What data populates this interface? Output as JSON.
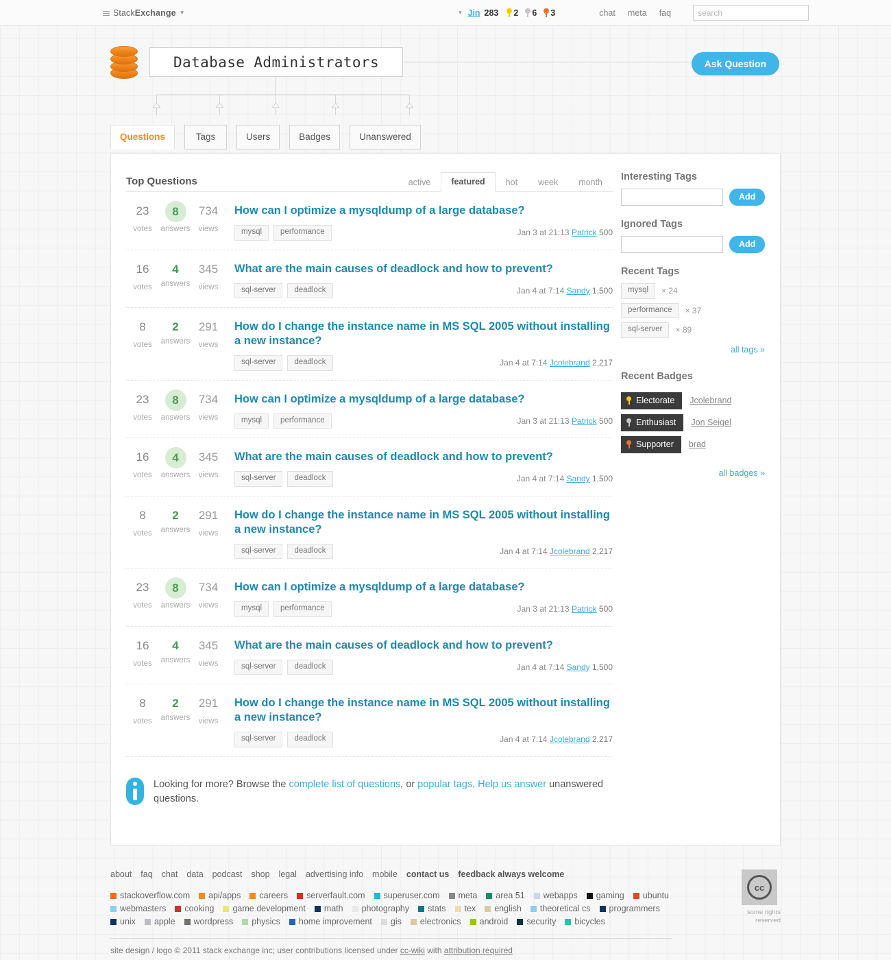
{
  "topbar": {
    "network_label_pre": "Stack",
    "network_label_bold": "Exchange",
    "user": {
      "name": "Jin",
      "reputation": "283"
    },
    "badges": [
      {
        "icon": "gold-badge-icon",
        "count": "2",
        "color": "#ffcc01"
      },
      {
        "icon": "silver-badge-icon",
        "count": "6",
        "color": "#c5c5c5"
      },
      {
        "icon": "bronze-badge-icon",
        "count": "3",
        "color": "#e8732d"
      }
    ],
    "links": [
      "chat",
      "meta",
      "faq"
    ],
    "search": {
      "value": "",
      "placeholder": "search"
    }
  },
  "site": {
    "title": "Database Administrators",
    "ask_button": "Ask Question",
    "tabs": [
      {
        "label": "Questions",
        "active": true
      },
      {
        "label": "Tags",
        "active": false
      },
      {
        "label": "Users",
        "active": false
      },
      {
        "label": "Badges",
        "active": false
      },
      {
        "label": "Unanswered",
        "active": false
      }
    ]
  },
  "main": {
    "heading": "Top Questions",
    "sorts": [
      {
        "label": "active",
        "active": false
      },
      {
        "label": "featured",
        "active": true
      },
      {
        "label": "hot",
        "active": false
      },
      {
        "label": "week",
        "active": false
      },
      {
        "label": "month",
        "active": false
      }
    ],
    "stat_labels": {
      "votes": "votes",
      "answers": "answers",
      "views": "views"
    },
    "questions": [
      {
        "votes": "23",
        "answers": "8",
        "views": "734",
        "answers_highlighted": true,
        "title": "How can I optimize a mysqldump of a large database?",
        "tags": [
          "mysql",
          "performance"
        ],
        "date": "Jan 3 at 21:13",
        "user": "Patrick",
        "rep": "500"
      },
      {
        "votes": "16",
        "answers": "4",
        "views": "345",
        "answers_highlighted": false,
        "title": "What are the main causes of deadlock and how to prevent?",
        "tags": [
          "sql-server",
          "deadlock"
        ],
        "date": "Jan 4 at 7:14",
        "user": "Sandy",
        "rep": "1,500"
      },
      {
        "votes": "8",
        "answers": "2",
        "views": "291",
        "answers_highlighted": false,
        "title": "How do I change the instance name in MS SQL 2005 without installing a new instance?",
        "tags": [
          "sql-server",
          "deadlock"
        ],
        "date": "Jan 4 at 7:14",
        "user": "Jcolebrand",
        "rep": "2,217"
      },
      {
        "votes": "23",
        "answers": "8",
        "views": "734",
        "answers_highlighted": true,
        "title": "How can I optimize a mysqldump of a large database?",
        "tags": [
          "mysql",
          "performance"
        ],
        "date": "Jan 3 at 21:13",
        "user": "Patrick",
        "rep": "500"
      },
      {
        "votes": "16",
        "answers": "4",
        "views": "345",
        "answers_highlighted": true,
        "title": "What are the main causes of deadlock and how to prevent?",
        "tags": [
          "sql-server",
          "deadlock"
        ],
        "date": "Jan 4 at 7:14",
        "user": "Sandy",
        "rep": "1,500"
      },
      {
        "votes": "8",
        "answers": "2",
        "views": "291",
        "answers_highlighted": false,
        "title": "How do I change the instance name in MS SQL 2005 without installing a new instance?",
        "tags": [
          "sql-server",
          "deadlock"
        ],
        "date": "Jan 4 at 7:14",
        "user": "Jcolebrand",
        "rep": "2,217"
      },
      {
        "votes": "23",
        "answers": "8",
        "views": "734",
        "answers_highlighted": true,
        "title": "How can I optimize a mysqldump of a large database?",
        "tags": [
          "mysql",
          "performance"
        ],
        "date": "Jan 3 at 21:13",
        "user": "Patrick",
        "rep": "500"
      },
      {
        "votes": "16",
        "answers": "4",
        "views": "345",
        "answers_highlighted": false,
        "title": "What are the main causes of deadlock and how to prevent?",
        "tags": [
          "sql-server",
          "deadlock"
        ],
        "date": "Jan 4 at 7:14",
        "user": "Sandy",
        "rep": "1,500"
      },
      {
        "votes": "8",
        "answers": "2",
        "views": "291",
        "answers_highlighted": false,
        "title": "How do I change the instance name in MS SQL 2005 without installing a new instance?",
        "tags": [
          "sql-server",
          "deadlock"
        ],
        "date": "Jan 4 at 7:14",
        "user": "Jcolebrand",
        "rep": "2,217"
      }
    ],
    "info_box": {
      "icon": "info-icon",
      "part1": "Looking for more? Browse the ",
      "link1": "complete list of questions",
      "part2": ", or ",
      "link2": "popular tags",
      "part3": ". ",
      "link3": "Help us answer",
      "part4": " unanswered questions."
    }
  },
  "sidebar": {
    "interesting_tags": {
      "heading": "Interesting Tags",
      "value": "",
      "placeholder": "",
      "add_label": "Add"
    },
    "ignored_tags": {
      "heading": "Ignored Tags",
      "value": "",
      "placeholder": "",
      "add_label": "Add"
    },
    "recent_tags": {
      "heading": "Recent Tags",
      "items": [
        {
          "tag": "mysql",
          "count": "× 24"
        },
        {
          "tag": "performance",
          "count": "× 37"
        },
        {
          "tag": "sql-server",
          "count": "× 89"
        }
      ],
      "all_link": "all tags »"
    },
    "recent_badges": {
      "heading": "Recent Badges",
      "items": [
        {
          "badge": "Electorate",
          "user": "Jcolebrand",
          "icon": "gold-badge-icon",
          "color": "#ffcc01"
        },
        {
          "badge": "Enthusiast",
          "user": "Jon Seigel",
          "icon": "silver-badge-icon",
          "color": "#c5c5c5"
        },
        {
          "badge": "Supporter",
          "user": "brad",
          "icon": "bronze-badge-icon",
          "color": "#e8732d"
        }
      ],
      "all_link": "all badges »"
    }
  },
  "footer": {
    "links": [
      {
        "label": "about",
        "bold": false
      },
      {
        "label": "faq",
        "bold": false
      },
      {
        "label": "chat",
        "bold": false
      },
      {
        "label": "data",
        "bold": false
      },
      {
        "label": "podcast",
        "bold": false
      },
      {
        "label": "shop",
        "bold": false
      },
      {
        "label": "legal",
        "bold": false
      },
      {
        "label": "advertising info",
        "bold": false
      },
      {
        "label": "mobile",
        "bold": false
      },
      {
        "label": "contact us",
        "bold": true
      },
      {
        "label": "feedback always welcome",
        "bold": true
      }
    ],
    "sites": [
      {
        "label": "stackoverflow.com",
        "color": "#f26c20"
      },
      {
        "label": "api/apps",
        "color": "#f58a20"
      },
      {
        "label": "careers",
        "color": "#f58a20"
      },
      {
        "label": "serverfault.com",
        "color": "#e02b20"
      },
      {
        "label": "superuser.com",
        "color": "#26b3e8"
      },
      {
        "label": "meta",
        "color": "#888888"
      },
      {
        "label": "area 51",
        "color": "#1a8c6c"
      },
      {
        "label": "webapps",
        "color": "#c9d8e8"
      },
      {
        "label": "gaming",
        "color": "#111111"
      },
      {
        "label": "ubuntu",
        "color": "#e04a1b"
      },
      {
        "label": "webmasters",
        "color": "#8ecff0"
      },
      {
        "label": "cooking",
        "color": "#cf3427"
      },
      {
        "label": "game development",
        "color": "#e8e87a"
      },
      {
        "label": "math",
        "color": "#12325e"
      },
      {
        "label": "photography",
        "color": "#e8e8e8"
      },
      {
        "label": "stats",
        "color": "#0b7a8c"
      },
      {
        "label": "tex",
        "color": "#f0dcb4"
      },
      {
        "label": "english",
        "color": "#dcc9a0"
      },
      {
        "label": "theoretical cs",
        "color": "#8ecff0"
      },
      {
        "label": "programmers",
        "color": "#12325e"
      },
      {
        "label": "unix",
        "color": "#12325e"
      },
      {
        "label": "apple",
        "color": "#bcbcc4"
      },
      {
        "label": "wordpress",
        "color": "#72726a"
      },
      {
        "label": "physics",
        "color": "#b4d8a8"
      },
      {
        "label": "home improvement",
        "color": "#2068b8"
      },
      {
        "label": "gis",
        "color": "#dcdcdc"
      },
      {
        "label": "electronics",
        "color": "#dcc9a0"
      },
      {
        "label": "android",
        "color": "#9cc413"
      },
      {
        "label": "security",
        "color": "#12323c"
      },
      {
        "label": "bicycles",
        "color": "#30c0a8"
      }
    ],
    "cc": {
      "mark": "cc",
      "caption_line1": "some rights",
      "caption_line2": "reserved"
    },
    "legal": {
      "pre": "site design / logo © 2011 stack exchange inc; user contributions licensed under ",
      "link1": "cc-wiki",
      "mid": " with ",
      "link2": "attribution required"
    }
  }
}
